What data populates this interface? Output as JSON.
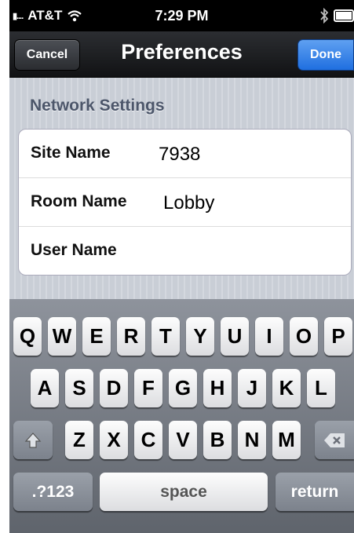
{
  "status_bar": {
    "carrier": "AT&T",
    "time": "7:29 PM"
  },
  "nav": {
    "title": "Preferences",
    "cancel_label": "Cancel",
    "done_label": "Done"
  },
  "section": {
    "title": "Network Settings"
  },
  "fields": [
    {
      "label": "Site Name",
      "value": "7938"
    },
    {
      "label": "Room Name",
      "value": "Lobby"
    },
    {
      "label": "User Name",
      "value": ""
    }
  ],
  "keyboard": {
    "row1": [
      "Q",
      "W",
      "E",
      "R",
      "T",
      "Y",
      "U",
      "I",
      "O",
      "P"
    ],
    "row2": [
      "A",
      "S",
      "D",
      "F",
      "G",
      "H",
      "J",
      "K",
      "L"
    ],
    "row3": [
      "Z",
      "X",
      "C",
      "V",
      "B",
      "N",
      "M"
    ],
    "mode_label": ".?123",
    "space_label": "space",
    "return_label": "return"
  }
}
